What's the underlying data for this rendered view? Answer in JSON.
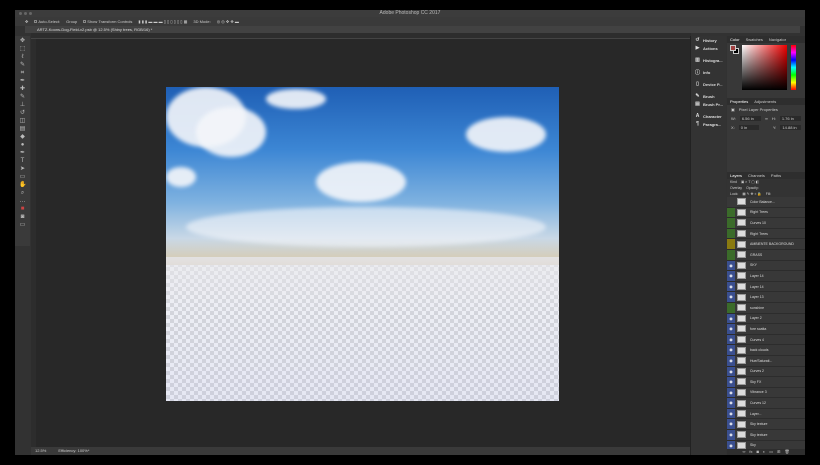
{
  "window": {
    "title": "Adobe Photoshop CC 2017"
  },
  "options": {
    "auto_select": "Auto-Select:",
    "group": "Group",
    "show_transform": "Show Transform Controls",
    "mode3d": "3D Mode:"
  },
  "document": {
    "tab": "ARTZ-Koons-Dog-Field-v2.psb @ 12.5% (Shiny trees, RGB/16) *"
  },
  "status": {
    "zoom": "12.5%",
    "info": "Efficiency: 100%*"
  },
  "tools": [
    "move",
    "marquee",
    "lasso",
    "quick-select",
    "crop",
    "eyedropper",
    "healing",
    "brush",
    "stamp",
    "history-brush",
    "eraser",
    "gradient",
    "blur",
    "dodge",
    "pen",
    "type",
    "path-select",
    "shape",
    "hand",
    "zoom",
    "more",
    "colors",
    "quick-mask",
    "screen-mode"
  ],
  "side_panels": [
    {
      "label": "History",
      "icon": "history-icon"
    },
    {
      "label": "Actions",
      "icon": "actions-icon"
    },
    {
      "label": "Histogra...",
      "icon": "histogram-icon"
    },
    {
      "label": "Info",
      "icon": "info-icon"
    },
    {
      "label": "Device P...",
      "icon": "device-preview-icon"
    },
    {
      "label": "Brush",
      "icon": "brush-icon"
    },
    {
      "label": "Brush Pr...",
      "icon": "brush-presets-icon"
    },
    {
      "label": "Character",
      "icon": "character-icon"
    },
    {
      "label": "Paragra...",
      "icon": "paragraph-icon"
    }
  ],
  "color_panel": {
    "tabs": [
      "Color",
      "Swatches",
      "Navigator"
    ],
    "fg": "#a04040"
  },
  "properties": {
    "tabs": [
      "Properties",
      "Adjustments"
    ],
    "title": "Pixel Layer Properties",
    "w": "6.56 in",
    "h": "1.76 in",
    "x": "0 in",
    "y": "14.88 in"
  },
  "layers_panel": {
    "tabs": [
      "Layers",
      "Channels",
      "Paths"
    ],
    "kind": "Kind",
    "blend": "Overlay",
    "opacity": "Opacity:",
    "lock": "Lock:",
    "fill": "Fill:",
    "layers": [
      {
        "name": "Color Balance...",
        "eye": "none"
      },
      {
        "name": "Right Trees",
        "eye": "green"
      },
      {
        "name": "Curves 10",
        "eye": "green"
      },
      {
        "name": "Right Trees",
        "eye": "green"
      },
      {
        "name": "AMBIENTE BACKGROUND",
        "eye": "yellow"
      },
      {
        "name": "GRASS",
        "eye": "green"
      },
      {
        "name": "SKY",
        "eye": "blue"
      },
      {
        "name": "Layer 14",
        "eye": "blue"
      },
      {
        "name": "Layer 14",
        "eye": "blue"
      },
      {
        "name": "Layer 13",
        "eye": "blue"
      },
      {
        "name": "sunshine",
        "eye": "green"
      },
      {
        "name": "Layer 2",
        "eye": "blue"
      },
      {
        "name": "fore scatta",
        "eye": "blue"
      },
      {
        "name": "Curves 4",
        "eye": "blue"
      },
      {
        "name": "back clouds",
        "eye": "blue"
      },
      {
        "name": "Hue/Saturati...",
        "eye": "blue"
      },
      {
        "name": "Curves 2",
        "eye": "blue"
      },
      {
        "name": "Sky FX",
        "eye": "blue"
      },
      {
        "name": "Vibrance 3",
        "eye": "blue"
      },
      {
        "name": "Curves 12",
        "eye": "blue"
      },
      {
        "name": "Layer...",
        "eye": "blue"
      },
      {
        "name": "Sky texture",
        "eye": "blue"
      },
      {
        "name": "Sky texture",
        "eye": "blue"
      },
      {
        "name": "Sky",
        "eye": "blue"
      }
    ]
  },
  "colors": {
    "green": "#3b6b2a",
    "yellow": "#8a7a10",
    "blue": "#3a4f8f",
    "none": "#383838"
  }
}
